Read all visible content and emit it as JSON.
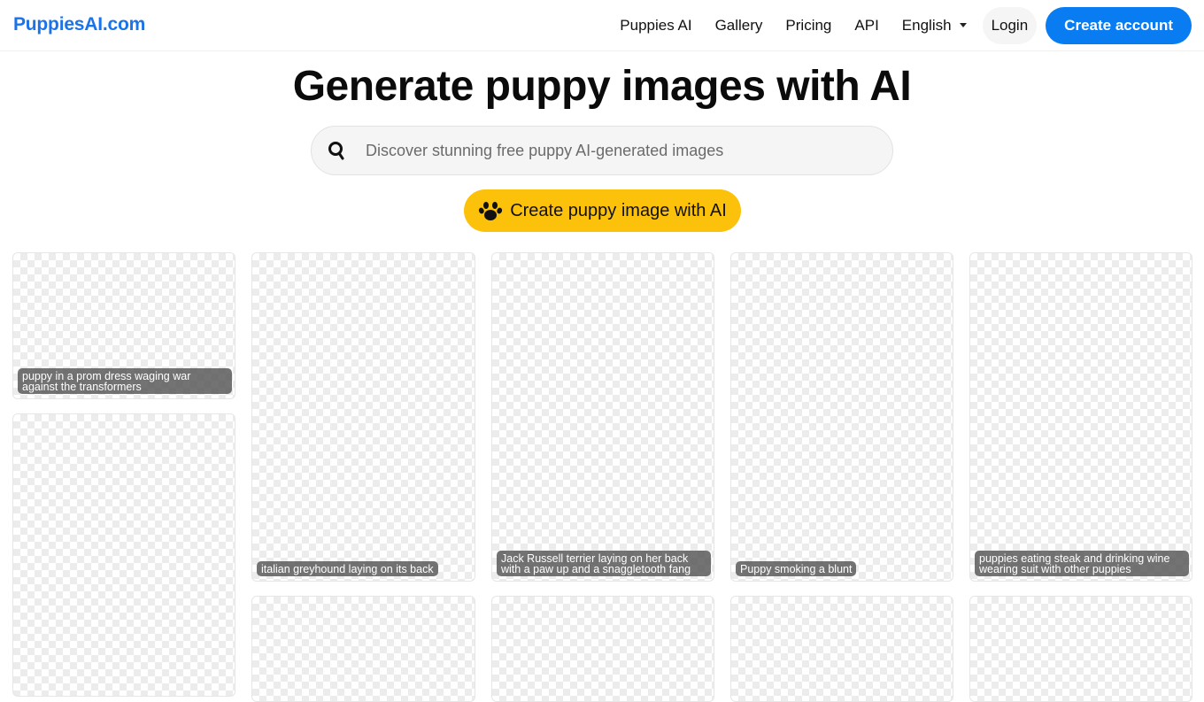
{
  "nav": {
    "brand": "PuppiesAI.com",
    "links": [
      "Puppies AI",
      "Gallery",
      "Pricing",
      "API"
    ],
    "language": "English",
    "login": "Login",
    "create_account": "Create account"
  },
  "hero": {
    "title": "Generate puppy images with AI",
    "search_placeholder": "Discover stunning free puppy AI-generated images",
    "search_value": "",
    "cta_label": "Create puppy image with AI"
  },
  "gallery": {
    "cards": [
      {
        "caption": "puppy in a prom dress waging war against the transformers"
      },
      {
        "caption": ""
      },
      {
        "caption": "italian greyhound laying on its back"
      },
      {
        "caption": ""
      },
      {
        "caption": "Jack Russell terrier laying on her back with a paw up and a snaggletooth fang"
      },
      {
        "caption": ""
      },
      {
        "caption": "Puppy smoking a blunt"
      },
      {
        "caption": ""
      },
      {
        "caption": "puppies eating steak and drinking wine wearing suit with other puppies"
      },
      {
        "caption": ""
      }
    ]
  },
  "colors": {
    "brand": "#1a73e8",
    "primary_button": "#0a7cf2",
    "cta": "#fcc10a"
  }
}
